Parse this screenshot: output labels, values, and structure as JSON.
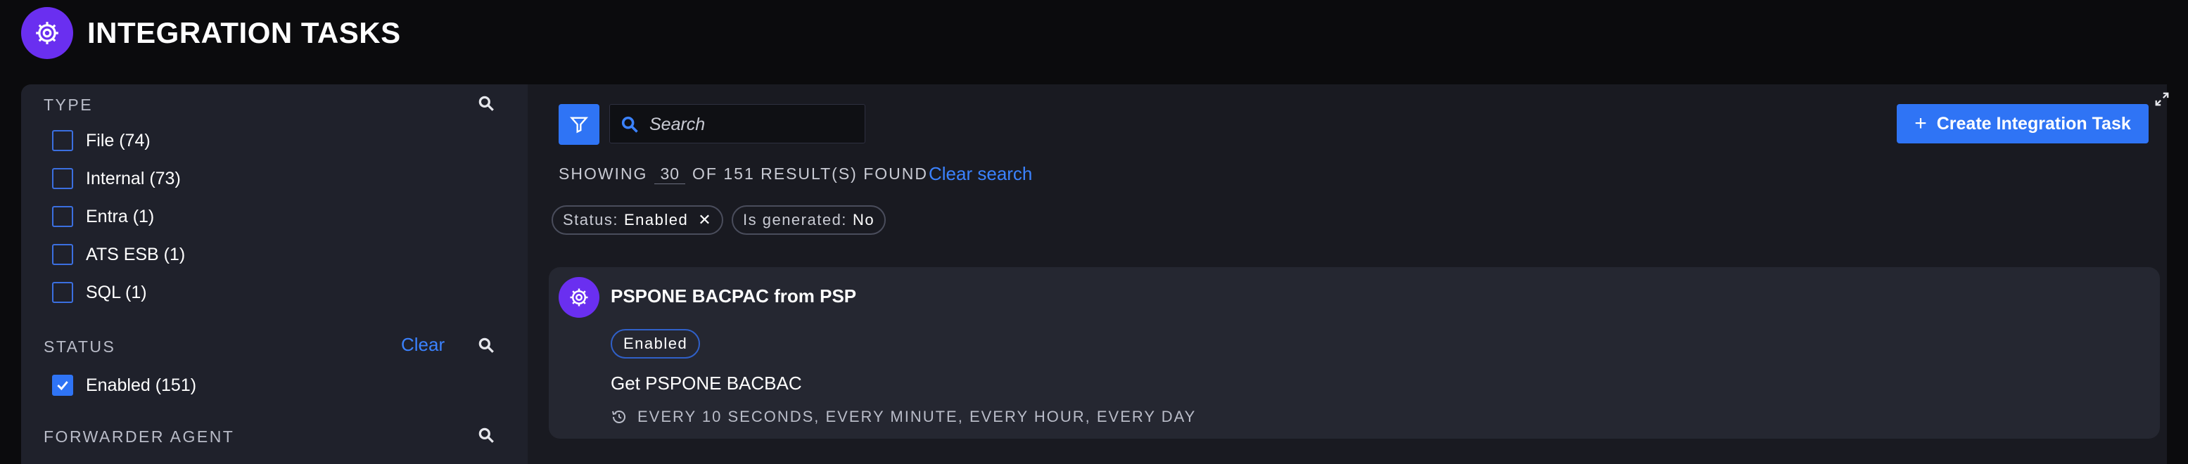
{
  "header": {
    "title": "INTEGRATION TASKS",
    "logo_icon": "gear-icon",
    "accent": "#6a2ff0"
  },
  "sidebar": {
    "type": {
      "heading": "TYPE",
      "options": [
        {
          "label": "File (74)",
          "checked": false
        },
        {
          "label": "Internal (73)",
          "checked": false
        },
        {
          "label": "Entra (1)",
          "checked": false
        },
        {
          "label": "ATS ESB (1)",
          "checked": false
        },
        {
          "label": "SQL (1)",
          "checked": false
        }
      ]
    },
    "status": {
      "heading": "STATUS",
      "clear_label": "Clear",
      "options": [
        {
          "label": "Enabled (151)",
          "checked": true
        }
      ]
    },
    "forwarder_agent": {
      "heading": "FORWARDER AGENT"
    }
  },
  "toolbar": {
    "search_placeholder": "Search",
    "create_label": "Create Integration Task",
    "primary_color": "#2f74f5"
  },
  "results": {
    "prefix": "SHOWING",
    "per_page": "30",
    "suffix": "OF 151 RESULT(S) FOUND",
    "clear_search": "Clear search"
  },
  "active_filters": [
    {
      "key": "Status:",
      "value": "Enabled",
      "removable": true
    },
    {
      "key": "Is generated:",
      "value": "No",
      "removable": false
    }
  ],
  "tasks": [
    {
      "title": "PSPONE BACPAC from PSP",
      "status": "Enabled",
      "description": "Get PSPONE BACBAC",
      "schedule": "EVERY 10 SECONDS, EVERY MINUTE, EVERY HOUR, EVERY DAY"
    }
  ]
}
